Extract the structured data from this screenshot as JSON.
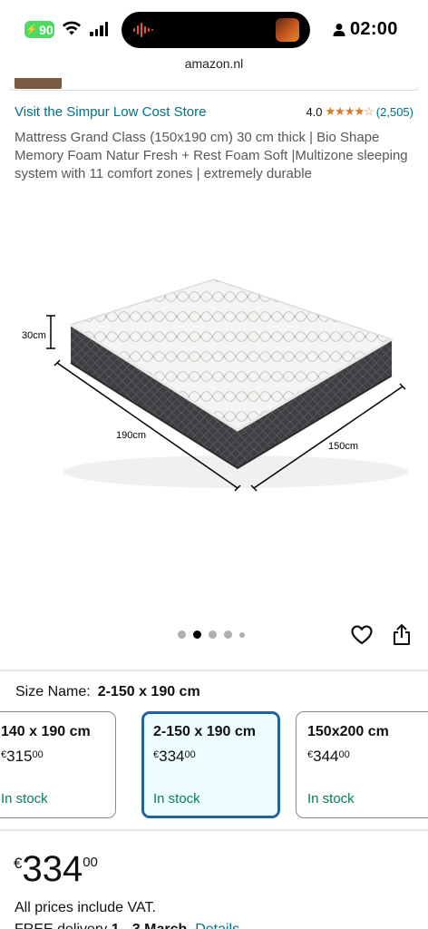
{
  "status_bar": {
    "battery": "90",
    "time": "02:00"
  },
  "browser": {
    "url": "amazon.nl"
  },
  "product": {
    "store_link": "Visit the Simpur Low Cost Store",
    "rating_value": "4.0",
    "rating_stars": 4,
    "rating_count": "(2,505)",
    "title": "Mattress Grand Class (150x190 cm) 30 cm thick | Bio Shape Memory Foam Natur Fresh + Rest Foam Soft |Multizone sleeping system with 11 comfort zones | extremely durable",
    "image_labels": {
      "height": "30cm",
      "length": "190cm",
      "width": "150cm"
    },
    "carousel": {
      "total": 5,
      "active_index": 1
    }
  },
  "size": {
    "label": "Size Name:",
    "selected": "2-150 x 190 cm",
    "options": [
      {
        "name": "140 x 190 cm",
        "currency": "€",
        "whole": "315",
        "cents": "00",
        "stock": "In stock",
        "selected": false
      },
      {
        "name": "2-150 x 190 cm",
        "currency": "€",
        "whole": "334",
        "cents": "00",
        "stock": "In stock",
        "selected": true
      },
      {
        "name": "150x200 cm",
        "currency": "€",
        "whole": "344",
        "cents": "00",
        "stock": "In stock",
        "selected": false
      }
    ]
  },
  "price": {
    "currency": "€",
    "whole": "334",
    "cents": "00",
    "vat_note": "All prices include VAT.",
    "delivery_prefix": "FREE delivery ",
    "delivery_date": "1 - 3 March.",
    "delivery_link": "Details"
  },
  "colors": {
    "link": "#007185",
    "star": "#de7921",
    "in_stock": "#067d62",
    "selected_border": "#2162a1",
    "selected_bg": "#edfdff",
    "battery": "#4cd964"
  },
  "icons": {
    "wishlist": "heart-icon",
    "share": "share-icon"
  }
}
